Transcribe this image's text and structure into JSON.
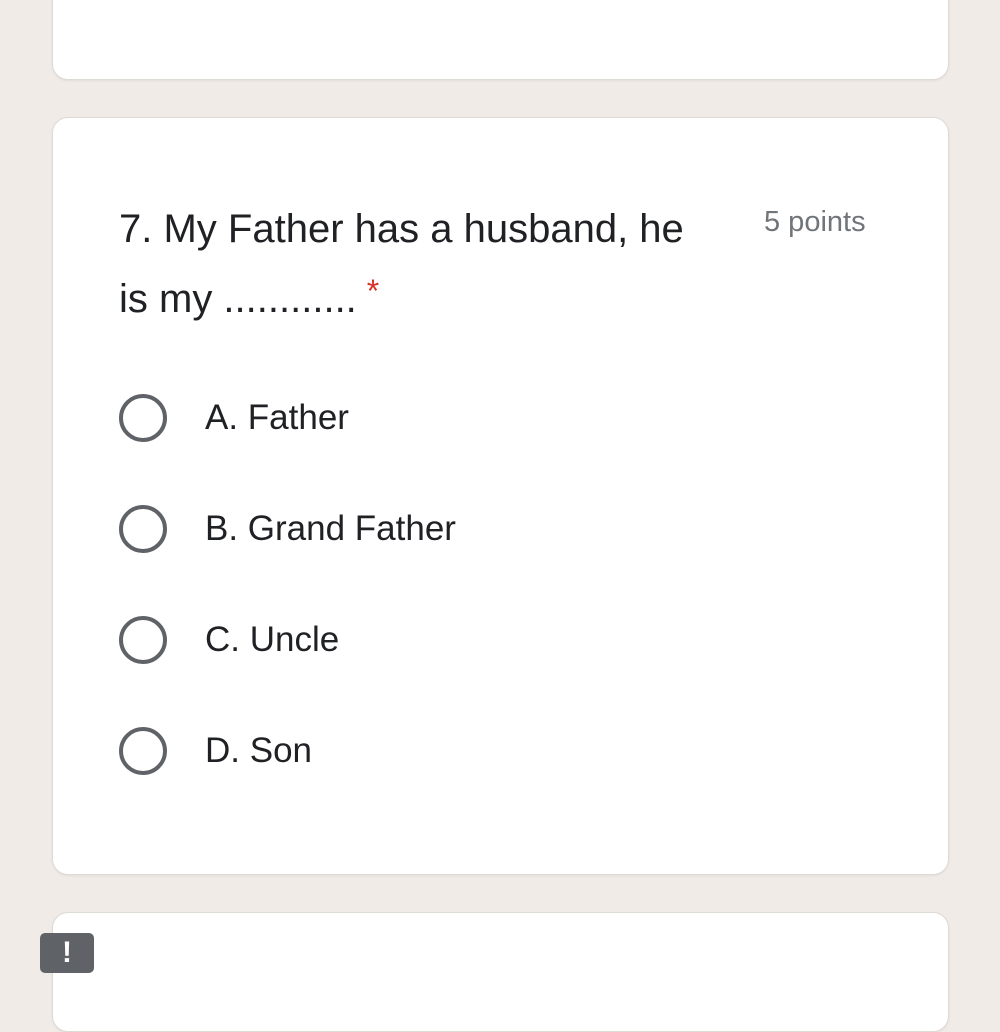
{
  "question": {
    "number": "7.",
    "title": "7. My Father has a husband, he is my ............",
    "required_mark": "*",
    "points": "5 points",
    "options": [
      {
        "label": "A. Father",
        "selected": false
      },
      {
        "label": "B. Grand Father",
        "selected": false
      },
      {
        "label": "C. Uncle",
        "selected": false
      },
      {
        "label": "D. Son",
        "selected": false
      }
    ]
  },
  "alert_badge": "!",
  "colors": {
    "background": "#f0ebe7",
    "card": "#ffffff",
    "required": "#d93025",
    "radio_border": "#5f6368",
    "text": "#202124",
    "muted_text": "#70757a"
  }
}
